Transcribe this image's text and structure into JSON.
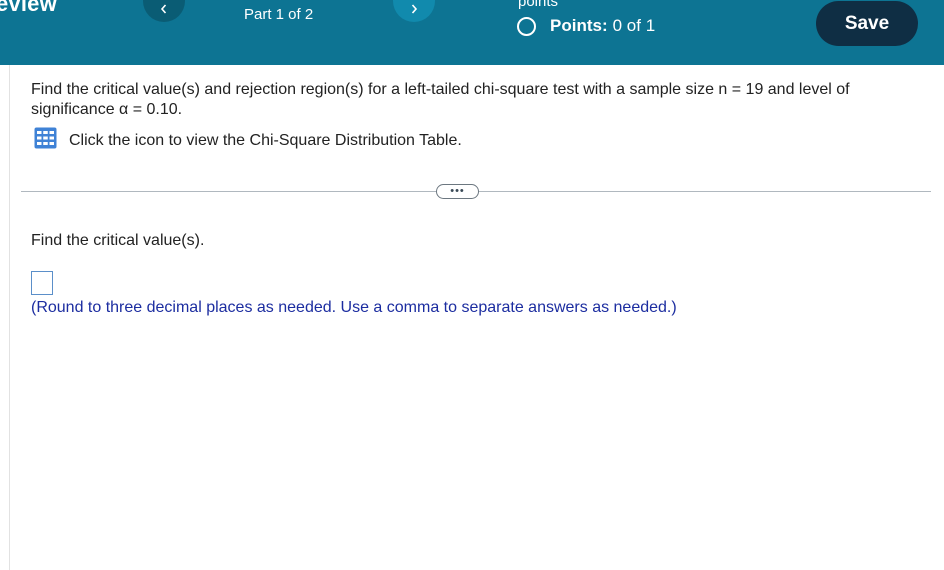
{
  "header": {
    "title_fragment": "eview",
    "part_label": "Part 1 of 2",
    "points_top_fragment": "points",
    "points_label": "Points:",
    "points_value": "0 of 1",
    "save_label": "Save",
    "colors": {
      "bar": "#0d7493",
      "save_bg": "#0f2e44"
    },
    "icons": {
      "prev": "chevron-left-icon",
      "next": "chevron-right-icon",
      "points": "circle-outline-icon"
    }
  },
  "question": {
    "text": "Find the critical value(s) and rejection region(s) for a left-tailed chi-square test with a sample size n = 19 and level of significance α = 0.10.",
    "table_link_text": "Click the icon to view the Chi-Square Distribution Table.",
    "table_icon": "table-grid-icon"
  },
  "more_button_label": "•••",
  "answer": {
    "prompt": "Find the critical value(s).",
    "value": "",
    "hint": "(Round to three decimal places as needed. Use a comma to separate answers as needed.)"
  }
}
